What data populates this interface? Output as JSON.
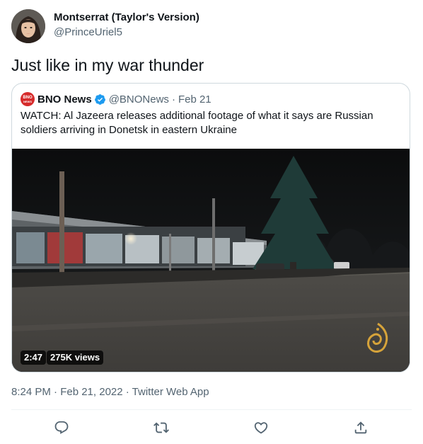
{
  "author": {
    "name": "Montserrat (Taylor's Version)",
    "handle": "@PrinceUriel5"
  },
  "tweet_text": "Just like in my war thunder",
  "quote": {
    "logo_text_line1": "BNO",
    "logo_text_line2": "NEWS",
    "name": "BNO News",
    "handle": "@BNONews",
    "separator": "·",
    "date": "Feb 21",
    "text": "WATCH: Al Jazeera releases additional footage of what it says are Russian soldiers arriving in Donetsk in eastern Ukraine",
    "video": {
      "duration": "2:47",
      "views": "275K views"
    }
  },
  "timestamp": "8:24 PM · Feb 21, 2022 · Twitter Web App",
  "actions": [
    "reply-icon",
    "retweet-icon",
    "like-icon",
    "share-icon"
  ],
  "colors": {
    "text_primary": "#0f1419",
    "text_secondary": "#536471",
    "verified_blue": "#1d9bf0",
    "border": "#cfd9de",
    "bno_red": "#d62b2b",
    "aljazeera_gold": "#d6a33a"
  }
}
